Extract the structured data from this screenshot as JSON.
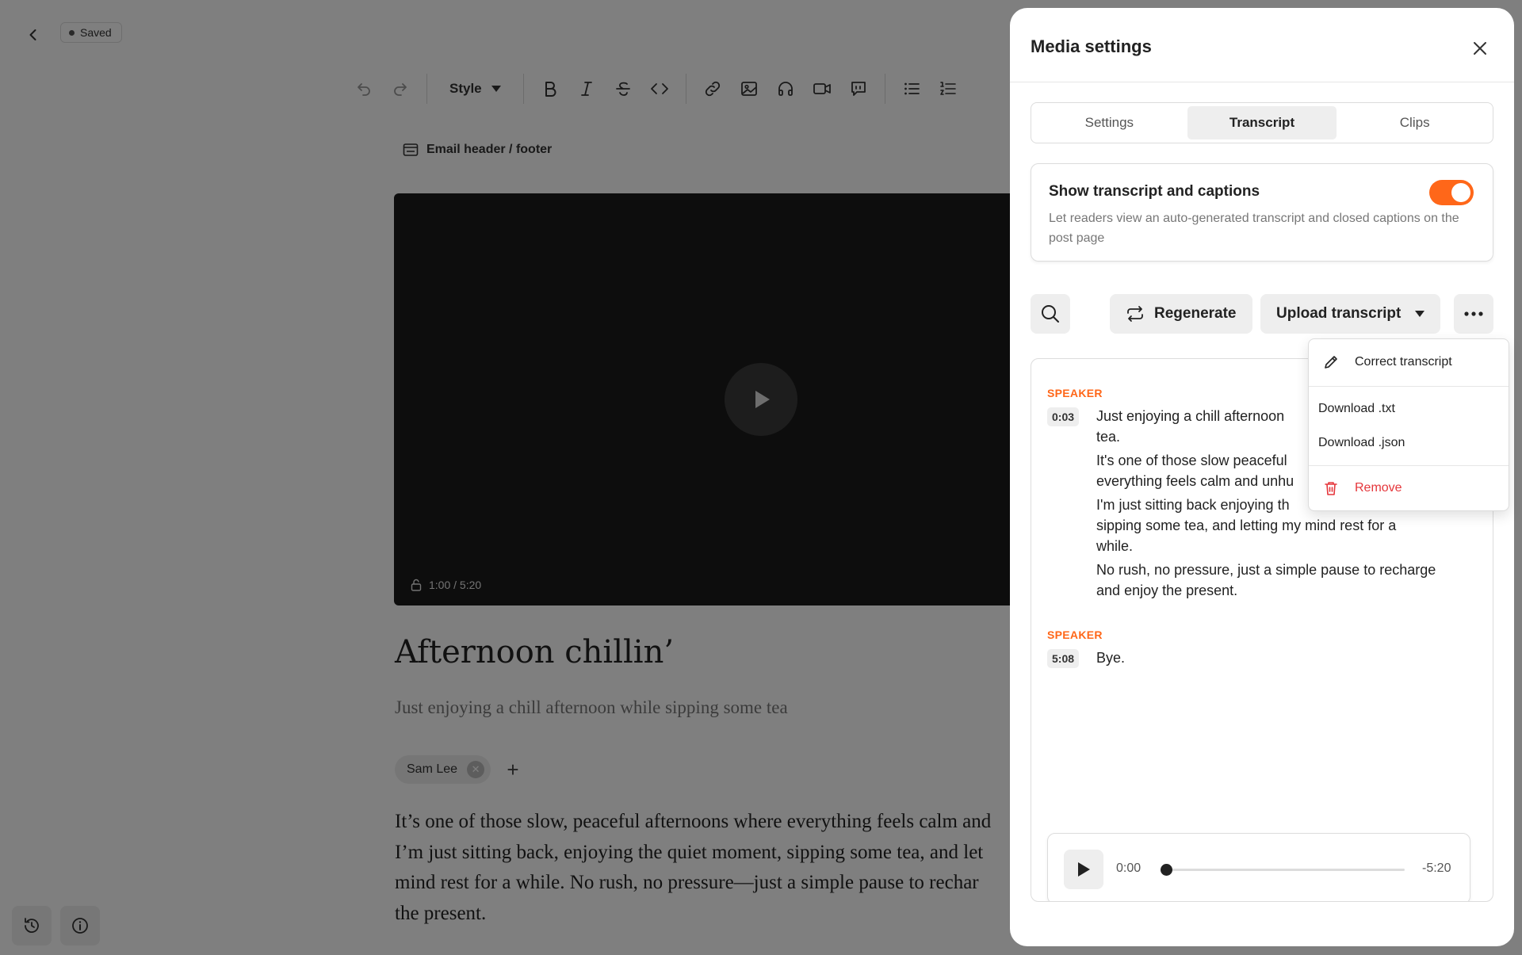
{
  "editor": {
    "saved_label": "Saved",
    "toolbar": {
      "style_label": "Style"
    },
    "header_footer_label": "Email header / footer",
    "video_time": "1:00 / 5:20",
    "post_title": "Afternoon chillin’",
    "post_subtitle": "Just enjoying a chill afternoon while sipping some tea",
    "author_name": "Sam Lee",
    "body_lines": [
      "It’s one of those slow, peaceful afternoons where everything feels calm and",
      "I’m just sitting back, enjoying the quiet moment, sipping some tea, and let",
      "mind rest for a while. No rush, no pressure—just a simple pause to rechar",
      "the present."
    ]
  },
  "modal": {
    "title": "Media settings",
    "tabs": [
      {
        "label": "Settings"
      },
      {
        "label": "Transcript"
      },
      {
        "label": "Clips"
      }
    ],
    "toggle": {
      "title": "Show transcript and captions",
      "description": "Let readers view an auto-generated transcript and closed captions on the post page",
      "on": true
    },
    "actions": {
      "regenerate_label": "Regenerate",
      "upload_label": "Upload transcript"
    },
    "transcript": [
      {
        "speaker": "SPEAKER",
        "time": "0:03",
        "lines": [
          "Just enjoying a chill afternoon",
          "tea.",
          "It's one of those slow peaceful",
          "everything feels calm and unhu",
          "I'm just sitting back enjoying th",
          "sipping some tea, and letting my mind rest for a",
          "while.",
          "No rush, no pressure, just a simple pause to recharge",
          "and enjoy the present."
        ]
      },
      {
        "speaker": "SPEAKER",
        "time": "5:08",
        "lines": [
          "Bye."
        ]
      }
    ],
    "player": {
      "current": "0:00",
      "remaining": "-5:20",
      "progress": 0
    },
    "menu": {
      "correct_label": "Correct transcript",
      "download_txt_label": "Download .txt",
      "download_json_label": "Download .json",
      "remove_label": "Remove"
    }
  },
  "colors": {
    "accent": "#ff6719",
    "danger": "#e5363b",
    "overlay": "rgba(0,0,0,0.5)"
  }
}
